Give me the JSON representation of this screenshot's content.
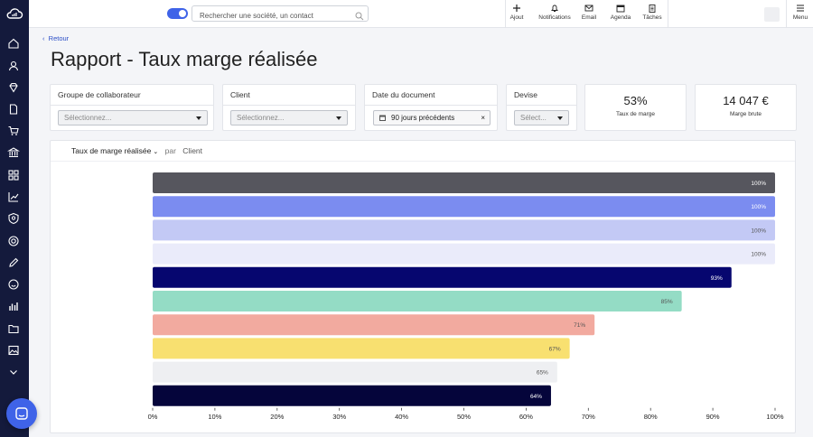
{
  "topbar": {
    "search_placeholder": "Rechercher une société, un contact",
    "actions": [
      {
        "label": "Ajout",
        "icon": "plus-icon"
      },
      {
        "label": "Notifications",
        "icon": "bell-icon"
      },
      {
        "label": "Email",
        "icon": "mail-icon"
      },
      {
        "label": "Agenda",
        "icon": "calendar-icon"
      },
      {
        "label": "Tâches",
        "icon": "clipboard-icon"
      }
    ],
    "menu_label": "Menu",
    "toggle_on": true
  },
  "sidebar": {
    "icons": [
      "home-icon",
      "user-icon",
      "diamond-icon",
      "document-icon",
      "cart-icon",
      "bank-icon",
      "grid-icon",
      "trend-icon",
      "badge-icon",
      "target-icon",
      "pencil-icon",
      "smiley-icon",
      "bars-icon",
      "folder-icon",
      "image-icon",
      "chevron-down-icon"
    ]
  },
  "back_label": "Retour",
  "page_title": "Rapport - Taux marge réalisée",
  "filters": {
    "group": {
      "label": "Groupe de collaborateur",
      "placeholder": "Sélectionnez..."
    },
    "client": {
      "label": "Client",
      "placeholder": "Sélectionnez..."
    },
    "date": {
      "label": "Date du document",
      "value": "90 jours précédents"
    },
    "currency": {
      "label": "Devise",
      "placeholder": "Sélect..."
    }
  },
  "kpis": [
    {
      "value": "53%",
      "label": "Taux de marge"
    },
    {
      "value": "14 047 €",
      "label": "Marge brute"
    }
  ],
  "chart_header": {
    "metric": "Taux de marge réalisée",
    "by": "par",
    "dimension": "Client"
  },
  "colors": {
    "sidebar": "#141a3c",
    "accent": "#3f63e8"
  },
  "chart_data": {
    "type": "bar",
    "orientation": "horizontal",
    "categories": [],
    "values": [
      100,
      100,
      100,
      100,
      93,
      85,
      71,
      67,
      65,
      64
    ],
    "value_labels": [
      "100%",
      "100%",
      "100%",
      "100%",
      "93%",
      "85%",
      "71%",
      "67%",
      "65%",
      "64%"
    ],
    "bar_colors": [
      "#56565e",
      "#7b8cf0",
      "#c3c9f5",
      "#eaebfa",
      "#06066f",
      "#94dcc5",
      "#f2aa9f",
      "#f8e070",
      "#eeeff2",
      "#05053b"
    ],
    "label_colors": [
      "#ffffff",
      "#ffffff",
      "#555555",
      "#555555",
      "#ffffff",
      "#555555",
      "#555555",
      "#555555",
      "#555555",
      "#ffffff"
    ],
    "x_ticks": [
      "0%",
      "10%",
      "20%",
      "30%",
      "40%",
      "50%",
      "60%",
      "70%",
      "80%",
      "90%",
      "100%"
    ],
    "xlim": [
      0,
      100
    ],
    "grid": false
  }
}
